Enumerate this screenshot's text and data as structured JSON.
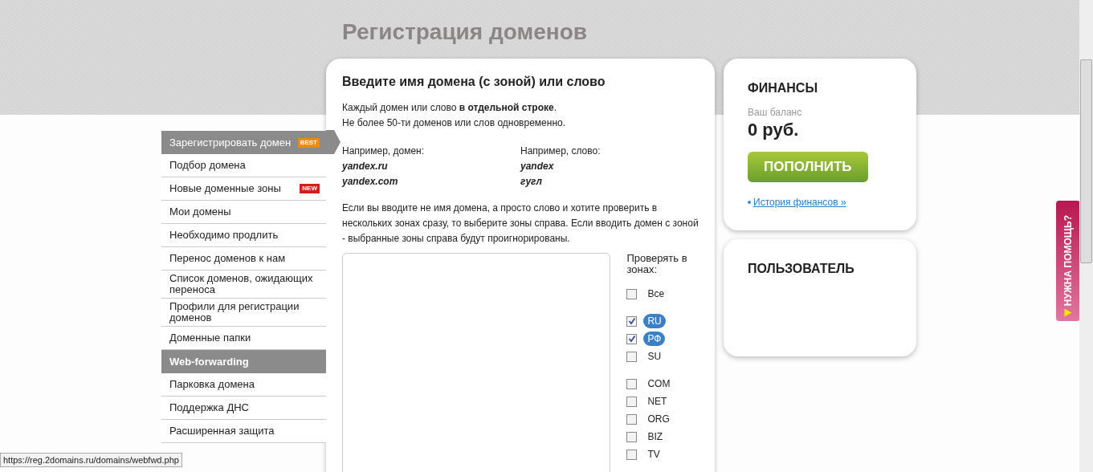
{
  "page_title": "Регистрация доменов",
  "menu": [
    {
      "label": "Зарегистрировать домен",
      "kind": "section",
      "selected": true,
      "badge": "BEST",
      "color": "#f08a00"
    },
    {
      "label": "Подбор домена",
      "kind": "item",
      "selected": false
    },
    {
      "label": "Новые доменные зоны",
      "kind": "item",
      "selected": false,
      "badge": "NEW",
      "color": "#d91a1a"
    },
    {
      "label": "Мои домены",
      "kind": "item",
      "selected": false
    },
    {
      "label": "Необходимо продлить",
      "kind": "item",
      "selected": false
    },
    {
      "label": "Перенос доменов к нам",
      "kind": "item",
      "selected": false
    },
    {
      "label": "Список доменов, ожидающих переноса",
      "kind": "item",
      "selected": false
    },
    {
      "label": "Профили для регистрации доменов",
      "kind": "item",
      "selected": false
    },
    {
      "label": "Доменные папки",
      "kind": "item",
      "selected": false
    },
    {
      "label": "Web-forwarding",
      "kind": "section",
      "selected": false
    },
    {
      "label": "Парковка домена",
      "kind": "item",
      "selected": false
    },
    {
      "label": "Поддержка ДНС",
      "kind": "item",
      "selected": false
    },
    {
      "label": "Расширенная защита",
      "kind": "item",
      "selected": false
    }
  ],
  "form": {
    "heading": "Введите имя домена (с зоной) или слово",
    "note_1": "Каждый домен или слово **в отдельной строке**.",
    "note_2": "Не более 50-ти доменов или слов одновременно.",
    "examples": [
      {
        "title": "Например, домен:",
        "values": [
          "yandex.ru",
          "yandex.com"
        ]
      },
      {
        "title": "Например, слово:",
        "values": [
          "yandex",
          "гугл"
        ]
      }
    ],
    "explanation": "Если вы вводите не имя домена, а просто слово и хотите проверить в нескольких зонах сразу, то выберите зоны справа. Если вводить домен с зоной - выбранные зоны справа будут проигнорированы.",
    "zones_title": "Проверять в зонах:",
    "zone_groups": [
      [
        {
          "label": "Все",
          "checked": false
        }
      ],
      [
        {
          "label": "RU",
          "checked": true
        },
        {
          "label": "РФ",
          "checked": true
        },
        {
          "label": "SU",
          "checked": false
        }
      ],
      [
        {
          "label": "COM",
          "checked": false
        },
        {
          "label": "NET",
          "checked": false
        },
        {
          "label": "ORG",
          "checked": false
        },
        {
          "label": "BIZ",
          "checked": false
        },
        {
          "label": "TV",
          "checked": false
        }
      ]
    ]
  },
  "finance": {
    "title": "ФИНАНСЫ",
    "balance_label": "Ваш баланс",
    "balance": "0 руб.",
    "button": "ПОПОЛНИТЬ",
    "link": "История финансов »"
  },
  "user": {
    "title": "ПОЛЬЗОВАТЕЛЬ"
  },
  "help_tab": "НУЖНА ПОМОЩЬ?",
  "status_url": "https://reg.2domains.ru/domains/webfwd.php"
}
